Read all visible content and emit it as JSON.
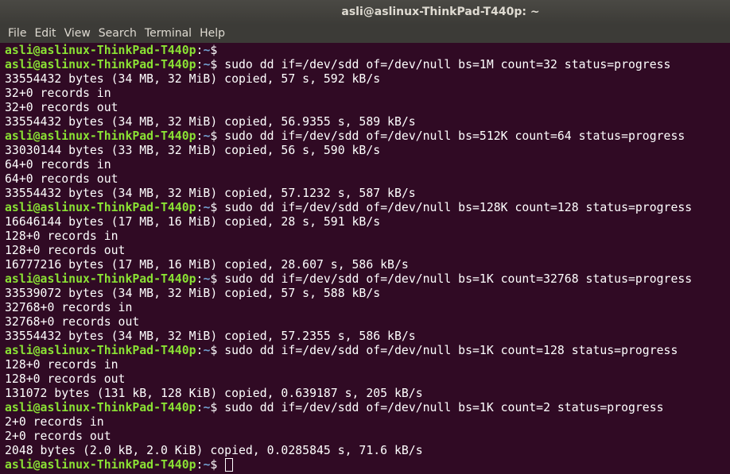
{
  "window": {
    "title": "asli@aslinux-ThinkPad-T440p: ~"
  },
  "menu": [
    "File",
    "Edit",
    "View",
    "Search",
    "Terminal",
    "Help"
  ],
  "terminal": {
    "prompt_user": "asli@aslinux-ThinkPad-T440p",
    "prompt_path": "~",
    "prompt_symbol": "$",
    "lines": [
      {
        "type": "prompt",
        "cmd": ""
      },
      {
        "type": "prompt",
        "cmd": " sudo dd if=/dev/sdd of=/dev/null bs=1M count=32 status=progress"
      },
      {
        "type": "out",
        "text": "33554432 bytes (34 MB, 32 MiB) copied, 57 s, 592 kB/s"
      },
      {
        "type": "out",
        "text": "32+0 records in"
      },
      {
        "type": "out",
        "text": "32+0 records out"
      },
      {
        "type": "out",
        "text": "33554432 bytes (34 MB, 32 MiB) copied, 56.9355 s, 589 kB/s"
      },
      {
        "type": "prompt",
        "cmd": " sudo dd if=/dev/sdd of=/dev/null bs=512K count=64 status=progress"
      },
      {
        "type": "out",
        "text": "33030144 bytes (33 MB, 32 MiB) copied, 56 s, 590 kB/s"
      },
      {
        "type": "out",
        "text": "64+0 records in"
      },
      {
        "type": "out",
        "text": "64+0 records out"
      },
      {
        "type": "out",
        "text": "33554432 bytes (34 MB, 32 MiB) copied, 57.1232 s, 587 kB/s"
      },
      {
        "type": "prompt",
        "cmd": " sudo dd if=/dev/sdd of=/dev/null bs=128K count=128 status=progress"
      },
      {
        "type": "out",
        "text": "16646144 bytes (17 MB, 16 MiB) copied, 28 s, 591 kB/s"
      },
      {
        "type": "out",
        "text": "128+0 records in"
      },
      {
        "type": "out",
        "text": "128+0 records out"
      },
      {
        "type": "out",
        "text": "16777216 bytes (17 MB, 16 MiB) copied, 28.607 s, 586 kB/s"
      },
      {
        "type": "prompt",
        "cmd": " sudo dd if=/dev/sdd of=/dev/null bs=1K count=32768 status=progress"
      },
      {
        "type": "out",
        "text": "33539072 bytes (34 MB, 32 MiB) copied, 57 s, 588 kB/s"
      },
      {
        "type": "out",
        "text": "32768+0 records in"
      },
      {
        "type": "out",
        "text": "32768+0 records out"
      },
      {
        "type": "out",
        "text": "33554432 bytes (34 MB, 32 MiB) copied, 57.2355 s, 586 kB/s"
      },
      {
        "type": "prompt",
        "cmd": " sudo dd if=/dev/sdd of=/dev/null bs=1K count=128 status=progress"
      },
      {
        "type": "out",
        "text": "128+0 records in"
      },
      {
        "type": "out",
        "text": "128+0 records out"
      },
      {
        "type": "out",
        "text": "131072 bytes (131 kB, 128 KiB) copied, 0.639187 s, 205 kB/s"
      },
      {
        "type": "prompt",
        "cmd": " sudo dd if=/dev/sdd of=/dev/null bs=1K count=2 status=progress"
      },
      {
        "type": "out",
        "text": "2+0 records in"
      },
      {
        "type": "out",
        "text": "2+0 records out"
      },
      {
        "type": "out",
        "text": "2048 bytes (2.0 kB, 2.0 KiB) copied, 0.0285845 s, 71.6 kB/s"
      },
      {
        "type": "prompt",
        "cmd": " ",
        "cursor": true
      }
    ]
  },
  "colors": {
    "background": "#300a24",
    "prompt_user": "#8ae234",
    "prompt_path": "#729fcf",
    "text": "#ffffff",
    "titlebar": "#3c3b37"
  }
}
